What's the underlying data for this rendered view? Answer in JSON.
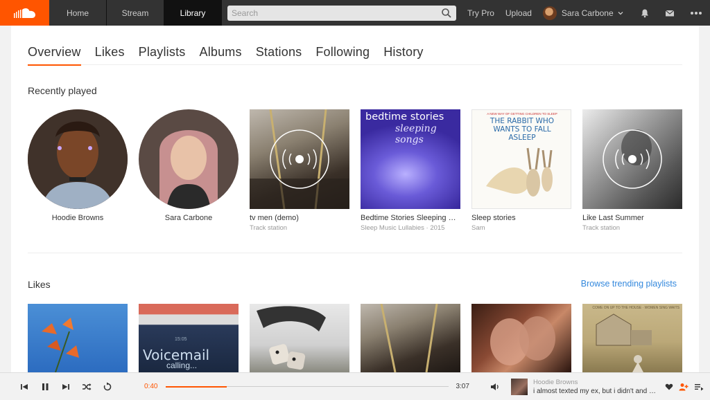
{
  "nav": {
    "tabs": [
      {
        "label": "Home"
      },
      {
        "label": "Stream"
      },
      {
        "label": "Library"
      }
    ],
    "search_placeholder": "Search",
    "try_pro": "Try Pro",
    "upload": "Upload",
    "user_name": "Sara Carbone",
    "icons": [
      "soundcloud-logo",
      "search-icon",
      "chevron-down-icon",
      "bell-icon",
      "mail-icon",
      "more-icon"
    ]
  },
  "library": {
    "tabs": [
      "Overview",
      "Likes",
      "Playlists",
      "Albums",
      "Stations",
      "Following",
      "History"
    ],
    "active_tab": "Overview",
    "recently_played_title": "Recently played",
    "recently_played": [
      {
        "name": "Hoodie Browns",
        "sub": "",
        "kind": "user"
      },
      {
        "name": "Sara Carbone",
        "sub": "",
        "kind": "user"
      },
      {
        "name": "tv men (demo)",
        "sub": "Track station",
        "kind": "station"
      },
      {
        "name": "Bedtime Stories Sleeping Songs",
        "sub": "Sleep Music Lullabies · 2015",
        "kind": "album"
      },
      {
        "name": "Sleep stories",
        "sub": "Sam",
        "kind": "playlist"
      },
      {
        "name": "Like Last Summer",
        "sub": "Track station",
        "kind": "station"
      }
    ],
    "album_art_text": {
      "bedtime_line1": "bedtime stories",
      "bedtime_line2": "sleeping songs",
      "rabbit_top": "A NEW WAY OF GETTING CHILDREN TO SLEEP",
      "rabbit_title": "THE RABBIT WHO WANTS TO FALL ASLEEP",
      "likes_voicemail": "Voicemail",
      "likes_calling": "calling...",
      "likes_time": "15:05",
      "likes_house": "COME ON UP TO THE HOUSE · WOMEN SING WAITS"
    },
    "likes_title": "Likes",
    "browse_link": "Browse trending playlists"
  },
  "player": {
    "current_time": "0:40",
    "duration": "3:07",
    "progress": 0.214,
    "artist": "Hoodie Browns",
    "title": "i almost texted my ex, but i didn't and you'll never know",
    "accent": "#ff5500"
  }
}
